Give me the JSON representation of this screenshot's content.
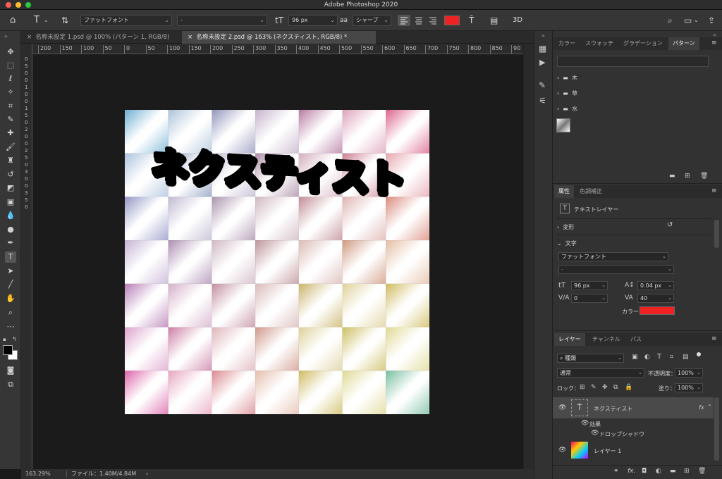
{
  "app": {
    "title": "Adobe Photoshop 2020"
  },
  "options": {
    "font_family": "ファットフォント",
    "font_style": "-",
    "font_size": "96 px",
    "aa_label": "a",
    "aa_mode": "シャープ",
    "color": "#ee2222"
  },
  "tabs": [
    {
      "label": "名称未設定 1.psd @ 100% (パターン 1, RGB/8)"
    },
    {
      "label": "名称未設定 2.psd @ 163% (ネクスティスト, RGB/8) *"
    }
  ],
  "rulers": {
    "h_ticks": [
      "200",
      "150",
      "100",
      "50",
      "0",
      "50",
      "100",
      "150",
      "200",
      "250",
      "300",
      "350",
      "400",
      "450",
      "500",
      "550",
      "600",
      "650",
      "700",
      "750",
      "800",
      "850",
      "90"
    ],
    "v_ticks": [
      "0",
      "5",
      "0",
      "0",
      "1",
      "0",
      "0",
      "1",
      "5",
      "0",
      "2",
      "0",
      "0",
      "2",
      "5",
      "0",
      "3",
      "0",
      "0",
      "3",
      "5",
      "0"
    ]
  },
  "canvas": {
    "headline": "ネクスティスト",
    "headline_color": "#ee2222"
  },
  "status": {
    "zoom": "163.29%",
    "file": "ファイル：1.40M/4.84M",
    "arrow": "›"
  },
  "patterns_panel": {
    "tabs": [
      "カラー",
      "スウォッチ",
      "グラデーション",
      "パターン"
    ],
    "active_tab": "パターン",
    "folders": [
      "木",
      "草",
      "水"
    ]
  },
  "properties_panel": {
    "tabs": [
      "属性",
      "色調補正"
    ],
    "layer_type": "テキストレイヤー",
    "transform_label": "変形",
    "text_label": "文字",
    "font_family": "ファットフォント",
    "font_style": "-",
    "size": "96 px",
    "leading": "0.04 px",
    "kerning": "0",
    "tracking": "40",
    "color_label": "カラー",
    "text_color": "#ee2222"
  },
  "layers_panel": {
    "tabs": [
      "レイヤー",
      "チャンネル",
      "パス"
    ],
    "filter": "種類",
    "blend_mode": "通常",
    "opacity_label": "不透明度：",
    "opacity": "100%",
    "lock_label": "ロック：",
    "fill_label": "塗り：",
    "fill": "100%",
    "layers": [
      {
        "name": "ネクスティスト",
        "fx": "fx",
        "effects_label": "効果",
        "effect": "ドロップシャドウ"
      },
      {
        "name": "レイヤー 1"
      }
    ]
  }
}
